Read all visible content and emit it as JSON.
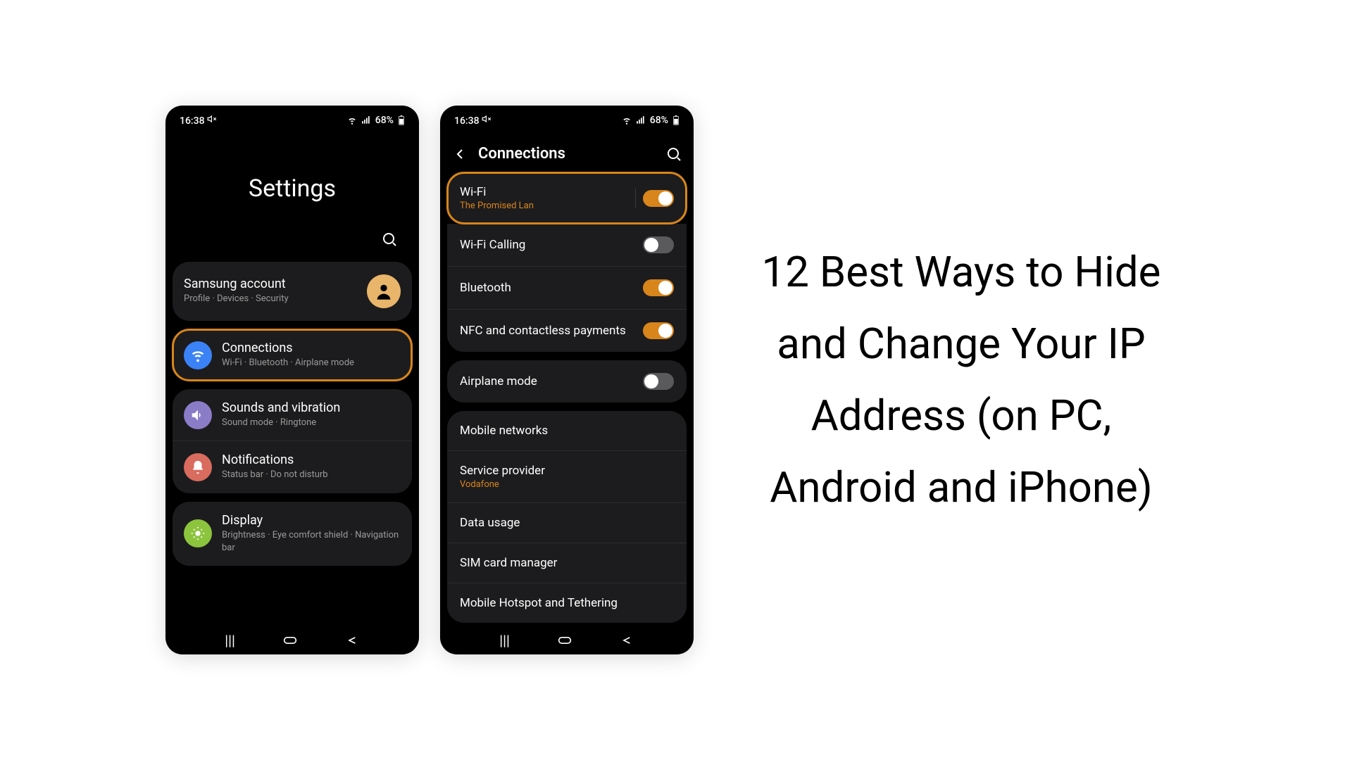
{
  "status_bar": {
    "time": "16:38",
    "battery_text": "68%"
  },
  "phone1": {
    "title": "Settings",
    "account": {
      "title": "Samsung account",
      "sub": "Profile  ·  Devices  ·  Security"
    },
    "items": [
      {
        "title": "Connections",
        "sub": "Wi-Fi  ·  Bluetooth  ·  Airplane mode",
        "highlighted": true
      },
      {
        "title": "Sounds and vibration",
        "sub": "Sound mode  ·  Ringtone"
      },
      {
        "title": "Notifications",
        "sub": "Status bar  ·  Do not disturb"
      },
      {
        "title": "Display",
        "sub": "Brightness  ·  Eye comfort shield  ·  Navigation bar"
      }
    ]
  },
  "phone2": {
    "title": "Connections",
    "groups": [
      [
        {
          "title": "Wi-Fi",
          "sub": "The Promised Lan",
          "toggle": true,
          "on": true,
          "highlighted": true
        },
        {
          "title": "Wi-Fi Calling",
          "toggle": true,
          "on": false
        },
        {
          "title": "Bluetooth",
          "toggle": true,
          "on": true
        },
        {
          "title": "NFC and contactless payments",
          "toggle": true,
          "on": true
        }
      ],
      [
        {
          "title": "Airplane mode",
          "toggle": true,
          "on": false
        }
      ],
      [
        {
          "title": "Mobile networks"
        },
        {
          "title": "Service provider",
          "sub": "Vodafone"
        },
        {
          "title": "Data usage"
        },
        {
          "title": "SIM card manager"
        },
        {
          "title": "Mobile Hotspot and Tethering"
        }
      ]
    ]
  },
  "headline": "12 Best Ways to Hide and Change Your IP Address (on PC, Android and iPhone)"
}
